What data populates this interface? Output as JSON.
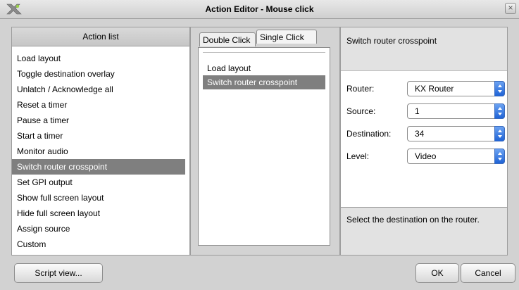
{
  "window": {
    "title": "Action Editor - Mouse click",
    "close_glyph": "×"
  },
  "action_list": {
    "header": "Action list",
    "items": [
      "Load layout",
      "Toggle destination overlay",
      "Unlatch / Acknowledge all",
      "Reset a timer",
      "Pause a timer",
      "Start a timer",
      "Monitor audio",
      "Switch router crosspoint",
      "Set GPI output",
      "Show full screen layout",
      "Hide full screen layout",
      "Assign source",
      "Custom"
    ],
    "selected_index": 7
  },
  "click_tabs": {
    "tabs": [
      "Double Click",
      "Single Click"
    ],
    "items": [
      "Load layout",
      "Switch router crosspoint"
    ],
    "selected_index": 1
  },
  "properties": {
    "description": "Switch router crosspoint",
    "router_label": "Router:",
    "router_value": "KX Router",
    "source_label": "Source:",
    "source_value": "1",
    "destination_label": "Destination:",
    "destination_value": "34",
    "level_label": "Level:",
    "level_value": "Video",
    "help_text": "Select the destination on the router."
  },
  "buttons": {
    "script_view": "Script view...",
    "ok": "OK",
    "cancel": "Cancel"
  },
  "colors": {
    "selection": "#7f7f7f",
    "spin_accent": "#1f63d6"
  }
}
